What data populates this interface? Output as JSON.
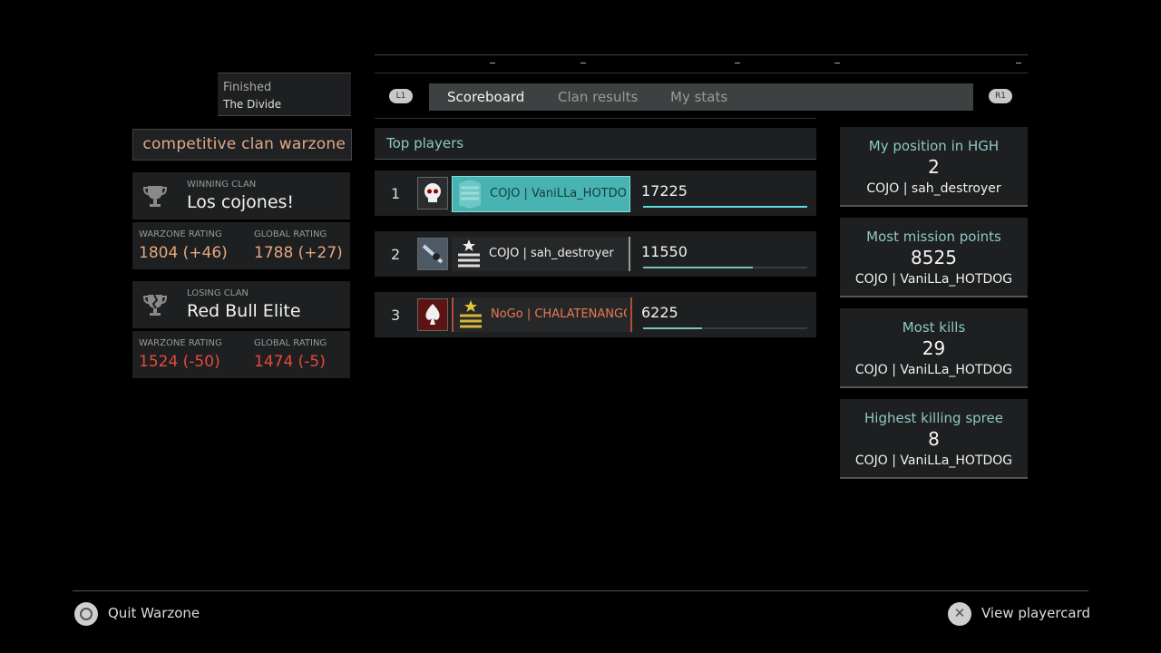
{
  "match": {
    "status": "Finished",
    "map": "The Divide",
    "mode": "competitive clan warzone"
  },
  "winning_clan": {
    "label": "WINNING CLAN",
    "name": "Los cojones!",
    "warzone_label": "WARZONE RATING",
    "warzone_value": "1804 (+46)",
    "global_label": "GLOBAL RATING",
    "global_value": "1788 (+27)"
  },
  "losing_clan": {
    "label": "LOSING CLAN",
    "name": "Red Bull Elite",
    "warzone_label": "WARZONE RATING",
    "warzone_value": "1524 (-50)",
    "global_label": "GLOBAL RATING",
    "global_value": "1474 (-5)"
  },
  "tabs": {
    "left_button": "L1",
    "right_button": "R1",
    "items": [
      "Scoreboard",
      "Clan results",
      "My stats"
    ],
    "active": "Scoreboard"
  },
  "top_players": {
    "title": "Top players",
    "rows": [
      {
        "rank": "1",
        "name": "COJO | VaniLLa_HOTDOG",
        "score": "17225",
        "score_value": 17225
      },
      {
        "rank": "2",
        "name": "COJO | sah_destroyer",
        "score": "11550",
        "score_value": 11550
      },
      {
        "rank": "3",
        "name": "NoGo | CHALATENANGO",
        "score": "6225",
        "score_value": 6225
      }
    ],
    "max_score": 17225
  },
  "my_stats": [
    {
      "title": "My position in HGH",
      "value": "2",
      "player": "COJO | sah_destroyer"
    },
    {
      "title": "Most mission points",
      "value": "8525",
      "player": "COJO | VaniLLa_HOTDOG"
    },
    {
      "title": "Most kills",
      "value": "29",
      "player": "COJO | VaniLLa_HOTDOG"
    },
    {
      "title": "Highest killing spree",
      "value": "8",
      "player": "COJO | VaniLLa_HOTDOG"
    }
  ],
  "footer": {
    "quit_label": "Quit Warzone",
    "playercard_label": "View playercard"
  },
  "colors": {
    "accent_teal": "#8ec8c3",
    "highlight_row": "#49b3b1",
    "win_rating": "#e7a77e",
    "lose_rating": "#e8493a",
    "enemy_name": "#e87a52",
    "bar_1": "#5fe0e0",
    "bar_other": "#7bc3b7"
  },
  "icons": {
    "winning_trophy": "trophy-icon",
    "losing_trophy": "trophy-broken-icon",
    "emblem_1": "skull-emblem-icon",
    "emblem_2": "weapon-emblem-icon",
    "emblem_3": "spade-emblem-icon",
    "quit_button": "circle-button-icon",
    "playercard_button": "cross-button-icon"
  }
}
